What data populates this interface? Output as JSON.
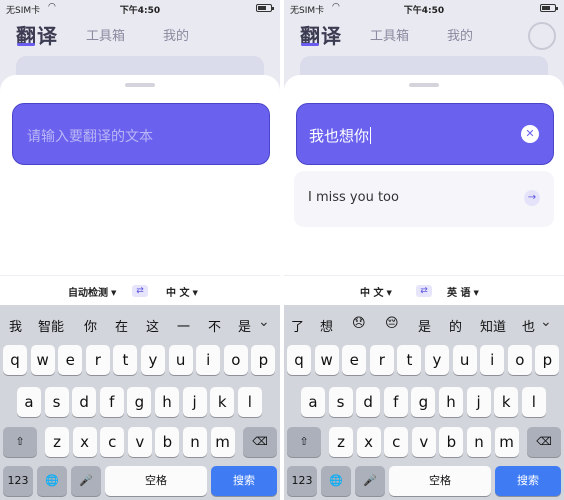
{
  "status": {
    "carrier": "无SIM卡",
    "time": "下午4:50",
    "wifi_icon": "wifi-icon",
    "battery_icon": "battery-icon"
  },
  "header": {
    "logo": "翻译",
    "tabs": [
      "工具箱",
      "我的"
    ]
  },
  "colors": {
    "accent": "#6a62ee",
    "search_key": "#3f7cf4",
    "keyboard_bg": "#d3d5dc"
  },
  "left": {
    "input": {
      "placeholder": "请输入要翻译的文本"
    },
    "lang": {
      "source": "自动检测",
      "target": "中 文",
      "swap_icon": "swap-arrows-icon"
    },
    "candidates": [
      "我",
      "智能",
      "你",
      "在",
      "这",
      "一",
      "不",
      "是"
    ],
    "chevron_icon": "chevron-down-icon"
  },
  "right": {
    "input": {
      "value": "我也想你",
      "clear_icon": "clear-x-icon"
    },
    "result": {
      "text": "I miss you too",
      "arrow_icon": "arrow-right-icon"
    },
    "lang": {
      "source": "中 文",
      "target": "英 语",
      "swap_icon": "swap-arrows-icon"
    },
    "candidates": [
      "了",
      "想",
      "😞",
      "😔",
      "是",
      "的",
      "知道",
      "也"
    ],
    "chevron_icon": "chevron-down-icon"
  },
  "keyboard": {
    "row1": [
      "q",
      "w",
      "e",
      "r",
      "t",
      "y",
      "u",
      "i",
      "o",
      "p"
    ],
    "row2": [
      "a",
      "s",
      "d",
      "f",
      "g",
      "h",
      "j",
      "k",
      "l"
    ],
    "row3": [
      "z",
      "x",
      "c",
      "v",
      "b",
      "n",
      "m"
    ],
    "shift": "⇧",
    "delete": "⌫",
    "numbers": "123",
    "globe": "🌐",
    "mic": "🎤",
    "space": "空格",
    "search": "搜索"
  }
}
